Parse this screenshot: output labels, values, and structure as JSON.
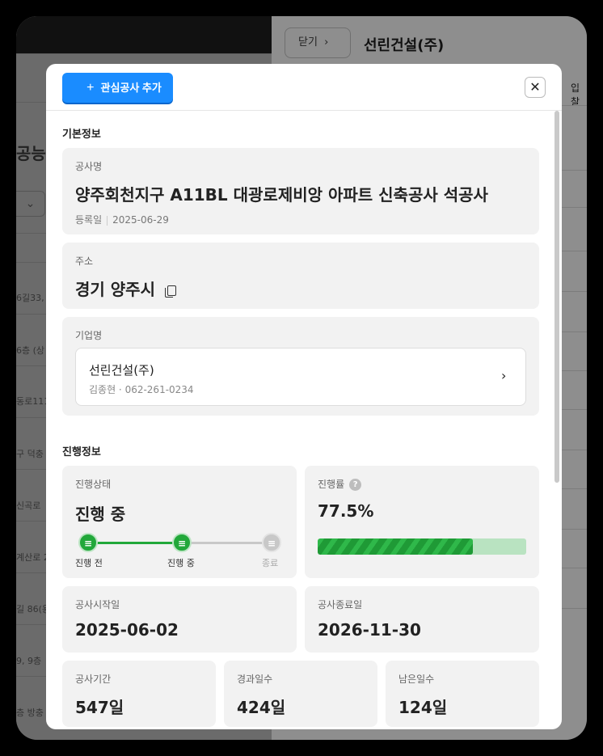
{
  "background": {
    "left_fragments": [
      "공능",
      "6길33,",
      "6층 (상",
      "동로111",
      "구 덕충",
      "신곡로",
      "계산로 2",
      "길 86(용",
      "9, 9층",
      "층 방충"
    ],
    "right_close_label": "닫기",
    "right_title": "선린건설(주)",
    "right_tab": "입찰"
  },
  "header": {
    "add_button_label": "관심공사 추가",
    "close_label": "✕"
  },
  "basic_info": {
    "section_title": "기본정보",
    "project_name_label": "공사명",
    "project_name": "양주회천지구 A11BL 대광로제비앙 아파트 신축공사 석공사",
    "registered_label": "등록일",
    "registered_date": "2025-06-29",
    "address_label": "주소",
    "address": "경기 양주시",
    "company_label": "기업명",
    "company_name": "선린건설(주)",
    "company_contact": "김종현 · 062-261-0234"
  },
  "progress_info": {
    "section_title": "진행정보",
    "status_label": "진행상태",
    "status_value": "진행 중",
    "steps": [
      {
        "label": "진행 전",
        "state": "done"
      },
      {
        "label": "진행 중",
        "state": "done"
      },
      {
        "label": "종료",
        "state": "todo"
      }
    ],
    "rate_label": "진행률",
    "rate_value": "77.5%",
    "rate_fraction": 0.745,
    "start_label": "공사시작일",
    "start_date": "2025-06-02",
    "end_label": "공사종료일",
    "end_date": "2026-11-30",
    "duration_label": "공사기간",
    "duration_value": "547일",
    "elapsed_label": "경과일수",
    "elapsed_value": "424일",
    "remaining_label": "남은일수",
    "remaining_value": "124일"
  },
  "colors": {
    "accent_blue": "#1a8cff",
    "status_green": "#22a83a"
  }
}
